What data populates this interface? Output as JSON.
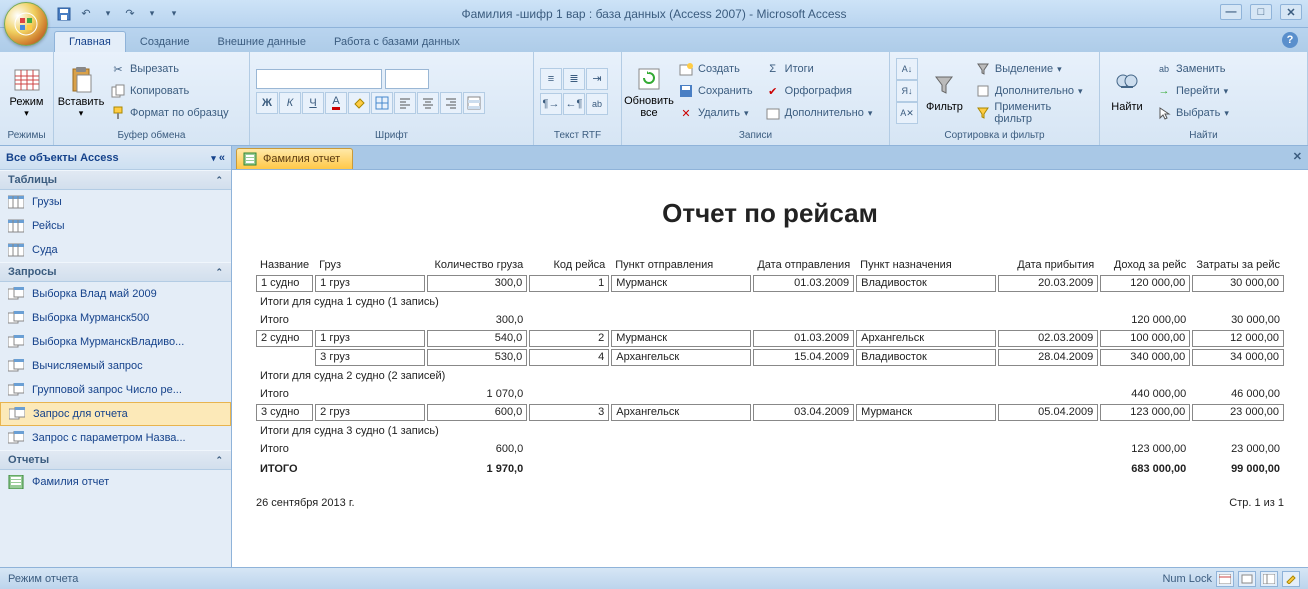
{
  "app_title": "Фамилия -шифр 1 вар : база данных (Access 2007) - Microsoft Access",
  "tabs": {
    "home": "Главная",
    "create": "Создание",
    "external": "Внешние данные",
    "dbtools": "Работа с базами данных"
  },
  "ribbon": {
    "modes": "Режимы",
    "mode_btn": "Режим",
    "clipboard": "Буфер обмена",
    "paste": "Вставить",
    "cut": "Вырезать",
    "copy": "Копировать",
    "format_painter": "Формат по образцу",
    "font": "Шрифт",
    "richtext": "Текст RTF",
    "records": "Записи",
    "refresh": "Обновить все",
    "new": "Создать",
    "save": "Сохранить",
    "delete": "Удалить",
    "totals": "Итоги",
    "spelling": "Орфография",
    "more": "Дополнительно",
    "sortfilter": "Сортировка и фильтр",
    "filter": "Фильтр",
    "selection": "Выделение",
    "advanced": "Дополнительно",
    "toggle_filter": "Применить фильтр",
    "find_grp": "Найти",
    "find": "Найти",
    "replace": "Заменить",
    "goto": "Перейти",
    "select": "Выбрать"
  },
  "nav": {
    "header": "Все объекты Access",
    "tables": "Таблицы",
    "tables_items": [
      "Грузы",
      "Рейсы",
      "Суда"
    ],
    "queries": "Запросы",
    "queries_items": [
      "Выборка Влад май 2009",
      "Выборка Мурманск500",
      "Выборка МурманскВладиво...",
      "Вычисляемый запрос",
      "Групповой запрос Число ре...",
      "Запрос для отчета",
      "Запрос с параметром Назва..."
    ],
    "reports": "Отчеты",
    "reports_items": [
      "Фамилия отчет"
    ]
  },
  "doc_tab": "Фамилия отчет",
  "report": {
    "title": "Отчет по рейсам",
    "columns": [
      "Название",
      "Груз",
      "Количество груза",
      "Код рейса",
      "Пункт отправления",
      "Дата отправления",
      "Пункт назначения",
      "Дата прибытия",
      "Доход за рейс",
      "Затраты за рейс"
    ],
    "groups": [
      {
        "rows": [
          {
            "name": "1 судно",
            "cargo": "1 груз",
            "qty": "300,0",
            "code": "1",
            "from": "Мурманск",
            "dep": "01.03.2009",
            "to": "Владивосток",
            "arr": "20.03.2009",
            "income": "120 000,00",
            "cost": "30 000,00"
          }
        ],
        "summary_label": "Итоги для судна 1 судно (1 запись)",
        "total_label": "Итого",
        "qty_total": "300,0",
        "income_total": "120 000,00",
        "cost_total": "30 000,00"
      },
      {
        "rows": [
          {
            "name": "2 судно",
            "cargo": "1 груз",
            "qty": "540,0",
            "code": "2",
            "from": "Мурманск",
            "dep": "01.03.2009",
            "to": "Архангельск",
            "arr": "02.03.2009",
            "income": "100 000,00",
            "cost": "12 000,00"
          },
          {
            "name": "",
            "cargo": "3 груз",
            "qty": "530,0",
            "code": "4",
            "from": "Архангельск",
            "dep": "15.04.2009",
            "to": "Владивосток",
            "arr": "28.04.2009",
            "income": "340 000,00",
            "cost": "34 000,00"
          }
        ],
        "summary_label": "Итоги для судна 2 судно (2 записей)",
        "total_label": "Итого",
        "qty_total": "1 070,0",
        "income_total": "440 000,00",
        "cost_total": "46 000,00"
      },
      {
        "rows": [
          {
            "name": "3 судно",
            "cargo": "2 груз",
            "qty": "600,0",
            "code": "3",
            "from": "Архангельск",
            "dep": "03.04.2009",
            "to": "Мурманск",
            "arr": "05.04.2009",
            "income": "123 000,00",
            "cost": "23 000,00"
          }
        ],
        "summary_label": "Итоги для судна 3 судно (1 запись)",
        "total_label": "Итого",
        "qty_total": "600,0",
        "income_total": "123 000,00",
        "cost_total": "23 000,00"
      }
    ],
    "grand_label": "ИТОГО",
    "grand_qty": "1 970,0",
    "grand_income": "683 000,00",
    "grand_cost": "99 000,00",
    "footer_date": "26 сентября 2013 г.",
    "footer_page": "Стр. 1 из 1"
  },
  "status": {
    "left": "Режим отчета",
    "numlock": "Num Lock"
  }
}
